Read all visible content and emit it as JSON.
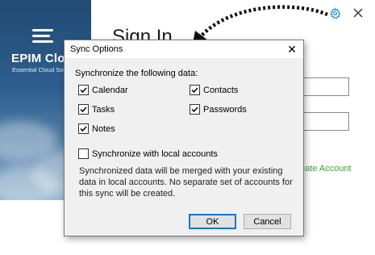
{
  "brand": {
    "name": "EPIM Clo",
    "tagline": "Essential Cloud Solu"
  },
  "signin": {
    "title": "Sign In",
    "create_account": "eate Account"
  },
  "icons": {
    "settings": "gear-icon",
    "close": "close-icon",
    "logo": "stacked-bars-logo-icon",
    "annotation_arrow": "dotted-arrow-icon"
  },
  "colors": {
    "accent_link": "#3f9b35",
    "settings_icon": "#2f8fd8",
    "focus_border": "#0078d7",
    "brand_panel": "#2e5f8f"
  },
  "dialog": {
    "title": "Sync Options",
    "close_glyph": "✕",
    "section_label": "Synchronize the following data:",
    "options": {
      "calendar": {
        "label": "Calendar",
        "checked": true
      },
      "contacts": {
        "label": "Contacts",
        "checked": true
      },
      "tasks": {
        "label": "Tasks",
        "checked": true
      },
      "passwords": {
        "label": "Passwords",
        "checked": true
      },
      "notes": {
        "label": "Notes",
        "checked": true
      }
    },
    "local_accounts": {
      "label": "Synchronize with local accounts",
      "checked": false
    },
    "note": "Synchronized data will be merged with your existing data in local accounts. No separate set of accounts for this sync will be created.",
    "ok_label": "OK",
    "cancel_label": "Cancel"
  }
}
